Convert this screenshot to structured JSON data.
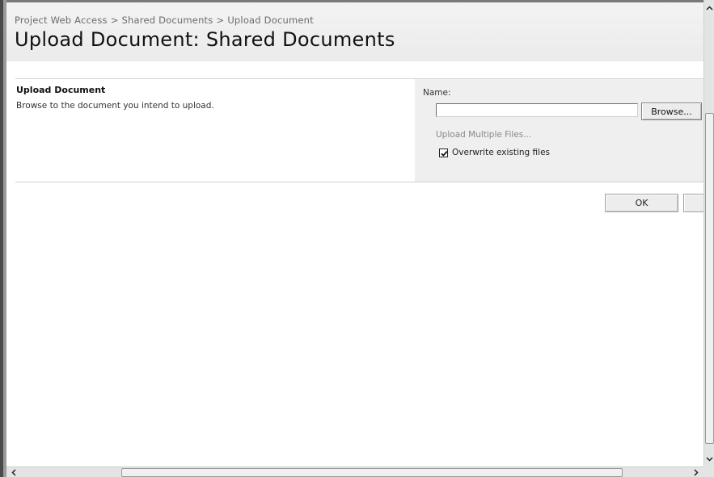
{
  "breadcrumb": {
    "items": [
      "Project Web Access",
      "Shared Documents",
      "Upload Document"
    ],
    "separator": ">"
  },
  "page_title": "Upload Document: Shared Documents",
  "section": {
    "title": "Upload Document",
    "description": "Browse to the document you intend to upload."
  },
  "form": {
    "name_label": "Name:",
    "name_value": "",
    "browse_label": "Browse...",
    "upload_multiple_label": "Upload Multiple Files...",
    "overwrite_label": "Overwrite existing files",
    "overwrite_checked": true
  },
  "actions": {
    "ok_label": "OK",
    "cancel_label": ""
  },
  "scrollbars": {
    "up_arrow": "▲",
    "down_arrow": "▼",
    "left_arrow": "<",
    "right_arrow": ">"
  }
}
